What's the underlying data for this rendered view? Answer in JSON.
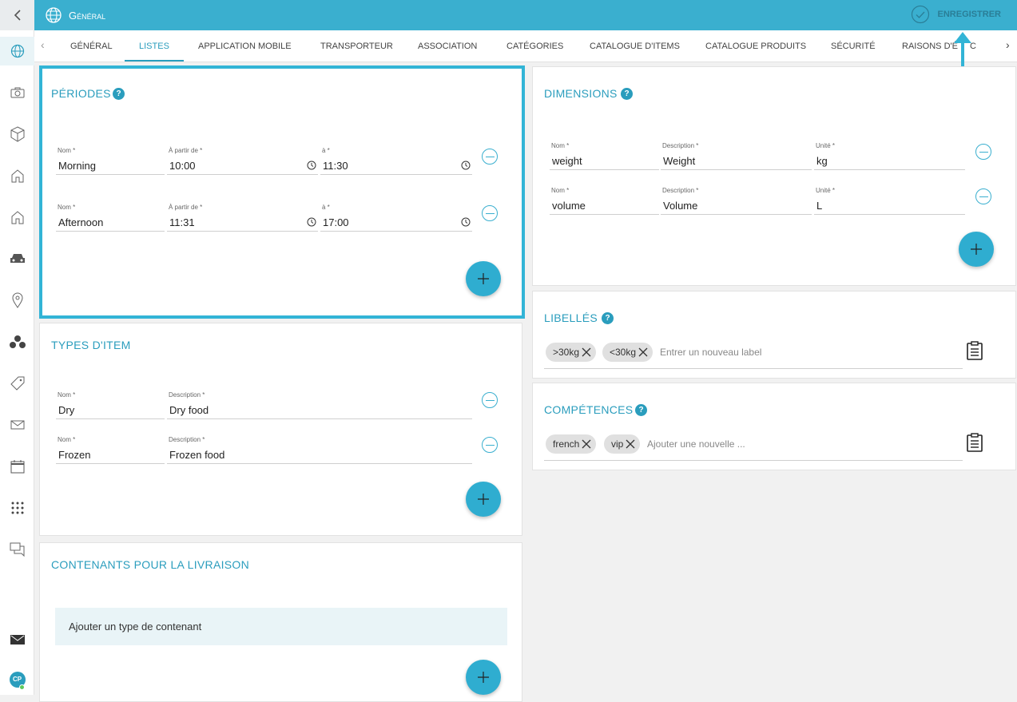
{
  "header": {
    "title": "Général",
    "save_label": "ENREGISTRER"
  },
  "tabs": [
    "GÉNÉRAL",
    "LISTES",
    "APPLICATION MOBILE",
    "TRANSPORTEUR",
    "ASSOCIATION",
    "CATÉGORIES",
    "CATALOGUE D'ITEMS",
    "CATALOGUE PRODUITS",
    "SÉCURITÉ",
    "RAISONS D'É"
  ],
  "tabs_tail": "C",
  "active_tab": "LISTES",
  "sidebar": {
    "avatar": "CP"
  },
  "periodes": {
    "title": "PÉRIODES",
    "help": "?",
    "labels": {
      "name": "Nom *",
      "from": "À partir de *",
      "to": "à *"
    },
    "rows": [
      {
        "name": "Morning",
        "from": "10:00",
        "to": "11:30"
      },
      {
        "name": "Afternoon",
        "from": "11:31",
        "to": "17:00"
      }
    ]
  },
  "types": {
    "title": "TYPES D'ITEM",
    "labels": {
      "name": "Nom *",
      "description": "Description *"
    },
    "rows": [
      {
        "name": "Dry",
        "description": "Dry food"
      },
      {
        "name": "Frozen",
        "description": "Frozen food"
      }
    ]
  },
  "contenants": {
    "title": "CONTENANTS POUR LA LIVRAISON",
    "add_label": "Ajouter un type de contenant"
  },
  "dimensions": {
    "title": "DIMENSIONS",
    "help": "?",
    "labels": {
      "name": "Nom *",
      "description": "Description *",
      "unit": "Unité *"
    },
    "rows": [
      {
        "name": "weight",
        "description": "Weight",
        "unit": "kg"
      },
      {
        "name": "volume",
        "description": "Volume",
        "unit": "L"
      }
    ]
  },
  "libelles": {
    "title": "LIBELLÉS",
    "help": "?",
    "chips": [
      ">30kg",
      "<30kg"
    ],
    "placeholder": "Entrer un nouveau label"
  },
  "competences": {
    "title": "COMPÉTENCES",
    "help": "?",
    "chips": [
      "french",
      "vip"
    ],
    "placeholder": "Ajouter une nouvelle ..."
  },
  "colors": {
    "accent": "#2a9dbd",
    "topbar": "#3aafcf",
    "highlight": "#32b4d6"
  }
}
